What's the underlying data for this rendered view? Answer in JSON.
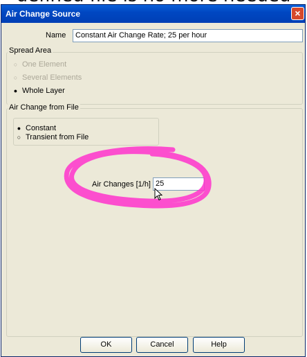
{
  "page_top_text": "defined file is no more needed",
  "window": {
    "title": "Air Change Source",
    "close_glyph": "×"
  },
  "name_field": {
    "label": "Name",
    "value": "Constant Air Change Rate; 25 per hour"
  },
  "spread_area": {
    "title": "Spread Area",
    "options": [
      {
        "label": "One Element",
        "selected": false,
        "enabled": false
      },
      {
        "label": "Several Elements",
        "selected": false,
        "enabled": false
      },
      {
        "label": "Whole Layer",
        "selected": true,
        "enabled": true
      }
    ]
  },
  "air_change_from_file": {
    "title": "Air Change from File",
    "options": [
      {
        "label": "Constant",
        "selected": true
      },
      {
        "label": "Transient from File",
        "selected": false
      }
    ],
    "air_changes_label": "Air Changes [1/h]",
    "air_changes_value": "25"
  },
  "buttons": {
    "ok": "OK",
    "cancel": "Cancel",
    "help": "Help"
  },
  "icons": {
    "selected_radio": "●",
    "unselected_radio": "○"
  },
  "colors": {
    "highlight_scribble": "#ff33cc",
    "title_bar": "#0047c2",
    "dialog_bg": "#ece9d8"
  }
}
